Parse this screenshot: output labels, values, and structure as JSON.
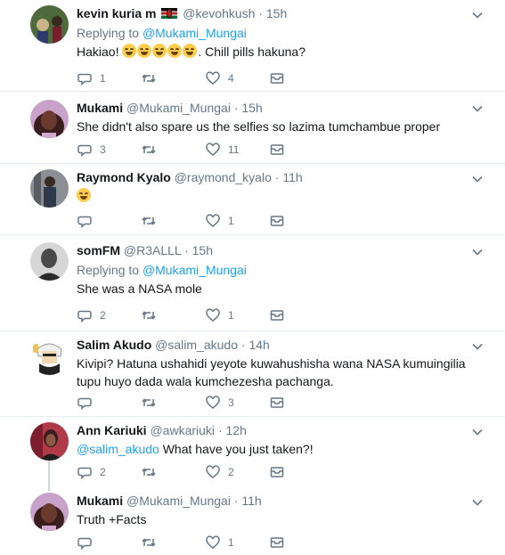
{
  "tweets": [
    {
      "name": "kevin kuria m",
      "handle": "@kevohkush",
      "time": "15h",
      "reply_prefix": "Replying to",
      "reply_to": "@Mukami_Mungai",
      "text_pre": "Hakiao!",
      "text_post": ". Chill pills hakuna?",
      "emoji_count": 5,
      "replies": "1",
      "retweets": "",
      "likes": "4",
      "avatar_colors": [
        "#4e6a3c",
        "#c9b48a"
      ]
    },
    {
      "name": "Mukami",
      "handle": "@Mukami_Mungai",
      "time": "15h",
      "text": "She didn't also spare us the selfies so lazima tumchambue proper",
      "replies": "3",
      "retweets": "",
      "likes": "11",
      "avatar_colors": [
        "#c8a2c8",
        "#6b3a2e"
      ]
    },
    {
      "name": "Raymond Kyalo",
      "handle": "@raymond_kyalo",
      "time": "11h",
      "text": "",
      "emoji_count": 1,
      "replies": "",
      "retweets": "",
      "likes": "1",
      "avatar_colors": [
        "#3b4a5c",
        "#8b8f93"
      ]
    },
    {
      "name": "somFM",
      "handle": "@R3ALLL",
      "time": "15h",
      "reply_prefix": "Replying to",
      "reply_to": "@Mukami_Mungai",
      "text": "She was a NASA mole",
      "replies": "2",
      "retweets": "",
      "likes": "1",
      "avatar_colors": [
        "#d6d6d6",
        "#4a4a4a"
      ]
    },
    {
      "name": "Salim Akudo",
      "handle": "@salim_akudo",
      "time": "14h",
      "text": "Kivipi? Hatuna ushahidi yeyote kuwahushisha wana NASA kumuingilia tupu huyo dada wala kumchezesha pachanga.",
      "replies": "",
      "retweets": "",
      "likes": "3",
      "avatar_colors": [
        "#ffffff",
        "#222222"
      ]
    },
    {
      "name": "Ann Kariuki",
      "handle": "@awkariuki",
      "time": "12h",
      "mention": "@salim_akudo",
      "text": "What have you just taken?!",
      "replies": "2",
      "retweets": "",
      "likes": "2",
      "avatar_colors": [
        "#b03a48",
        "#3a1e1e"
      ]
    },
    {
      "name": "Mukami",
      "handle": "@Mukami_Mungai",
      "time": "11h",
      "text": "Truth +Facts",
      "replies": "",
      "retweets": "",
      "likes": "1",
      "avatar_colors": [
        "#c8a2c8",
        "#6b3a2e"
      ]
    }
  ],
  "separator": "·",
  "colors": {
    "link": "#1da1f2",
    "muted": "#657786",
    "divider": "#e6ecf0",
    "thread": "#ccd6dd"
  }
}
